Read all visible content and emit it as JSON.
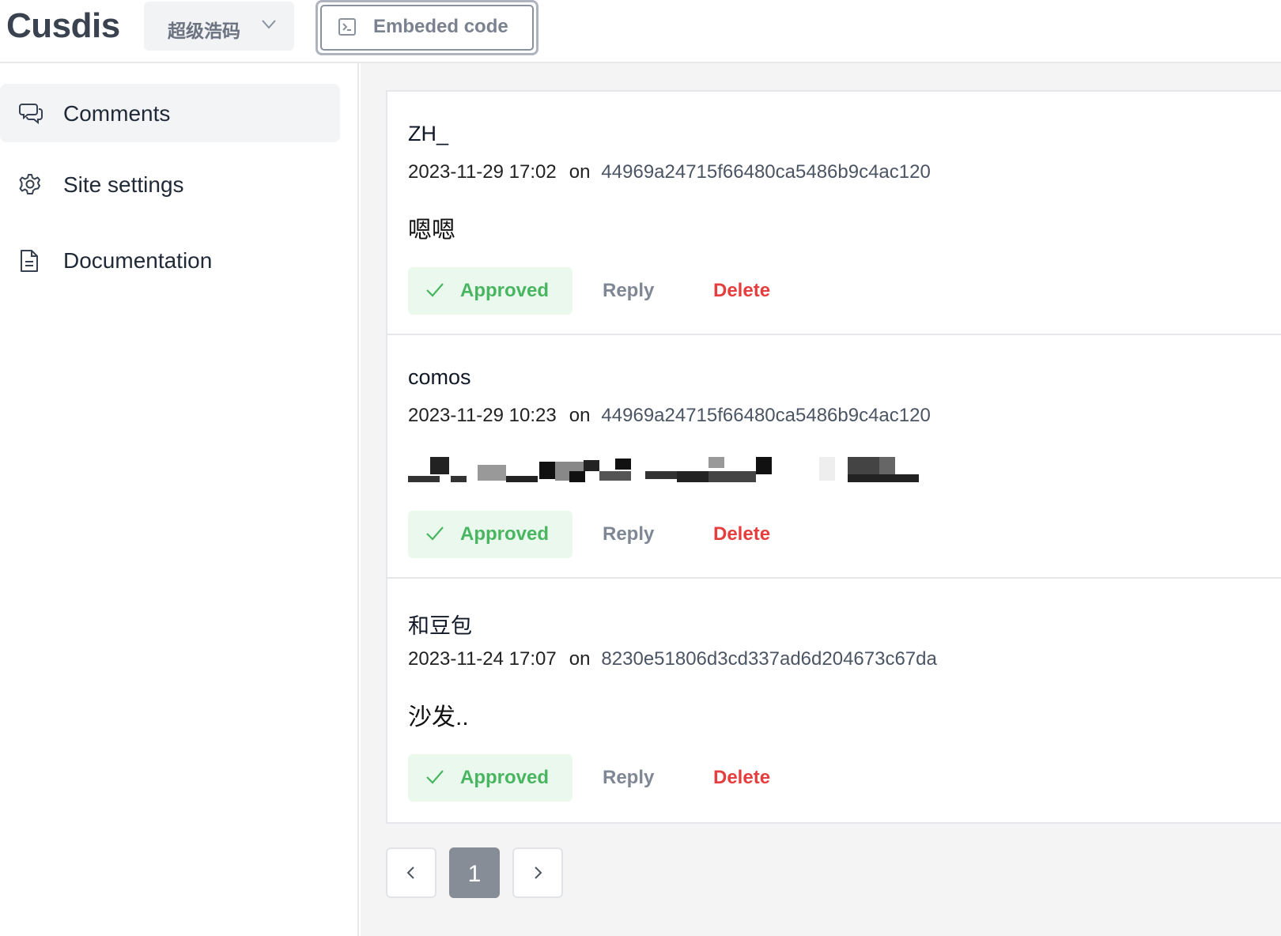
{
  "app": {
    "name": "Cusdis"
  },
  "header": {
    "site_selector": {
      "value": "超级浩码"
    },
    "embed_button": {
      "label": "Embeded code"
    }
  },
  "sidebar": {
    "items": [
      {
        "label": "Comments",
        "icon": "chat-bubbles-icon",
        "active": true
      },
      {
        "label": "Site settings",
        "icon": "gear-icon"
      },
      {
        "label": "Documentation",
        "icon": "document-icon"
      }
    ]
  },
  "comments": [
    {
      "author": "ZH_",
      "date": "2023-11-29 17:02",
      "on": "on",
      "page_id": "44969a24715f66480ca5486b9c4ac120",
      "body": "嗯嗯",
      "status": "Approved",
      "reply": "Reply",
      "delete": "Delete"
    },
    {
      "author": "comos",
      "date": "2023-11-29 10:23",
      "on": "on",
      "page_id": "44969a24715f66480ca5486b9c4ac120",
      "body": "",
      "status": "Approved",
      "reply": "Reply",
      "delete": "Delete"
    },
    {
      "author": "和豆包",
      "date": "2023-11-24 17:07",
      "on": "on",
      "page_id": "8230e51806d3cd337ad6d204673c67da",
      "body": "沙发..",
      "status": "Approved",
      "reply": "Reply",
      "delete": "Delete"
    }
  ],
  "pagination": {
    "current": "1"
  },
  "colors": {
    "approved_text": "#48b660",
    "approved_bg": "#ebf8ee",
    "delete": "#e53e3e",
    "muted": "#7f8794"
  }
}
